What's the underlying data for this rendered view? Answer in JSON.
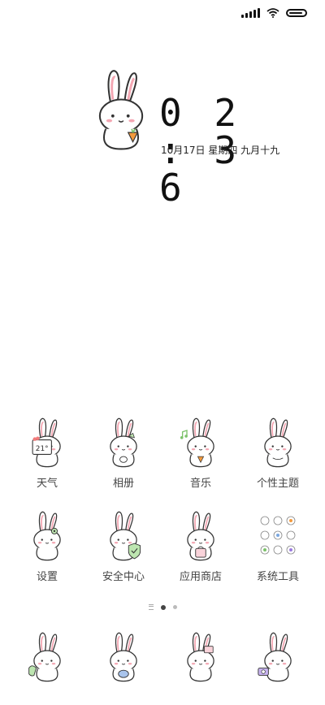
{
  "status_bar": {
    "signal_icon": "cellular-signal-icon",
    "wifi_icon": "wifi-icon",
    "battery_icon": "battery-icon",
    "battery_level": 0.9
  },
  "clock": {
    "time": "02:36",
    "date": "10月17日 星期四 九月十九"
  },
  "apps": [
    {
      "label": "天气",
      "icon": "weather-bunny-icon",
      "badge": "21°"
    },
    {
      "label": "相册",
      "icon": "gallery-bunny-icon"
    },
    {
      "label": "音乐",
      "icon": "music-bunny-icon"
    },
    {
      "label": "个性主题",
      "icon": "themes-bunny-icon"
    },
    {
      "label": "设置",
      "icon": "settings-bunny-icon"
    },
    {
      "label": "安全中心",
      "icon": "security-bunny-icon"
    },
    {
      "label": "应用商店",
      "icon": "app-store-bunny-icon"
    },
    {
      "label": "系统工具",
      "icon": "system-tools-folder-icon"
    }
  ],
  "page_indicator": {
    "pages": 2,
    "current": 1
  },
  "dock": [
    {
      "icon": "phone-bunny-icon"
    },
    {
      "icon": "messages-bunny-icon"
    },
    {
      "icon": "browser-bunny-icon"
    },
    {
      "icon": "camera-bunny-icon"
    }
  ],
  "colors": {
    "background": "#ffffff",
    "line": "#333333",
    "blush": "#f4a7b3",
    "accent_green": "#7cc26a"
  }
}
